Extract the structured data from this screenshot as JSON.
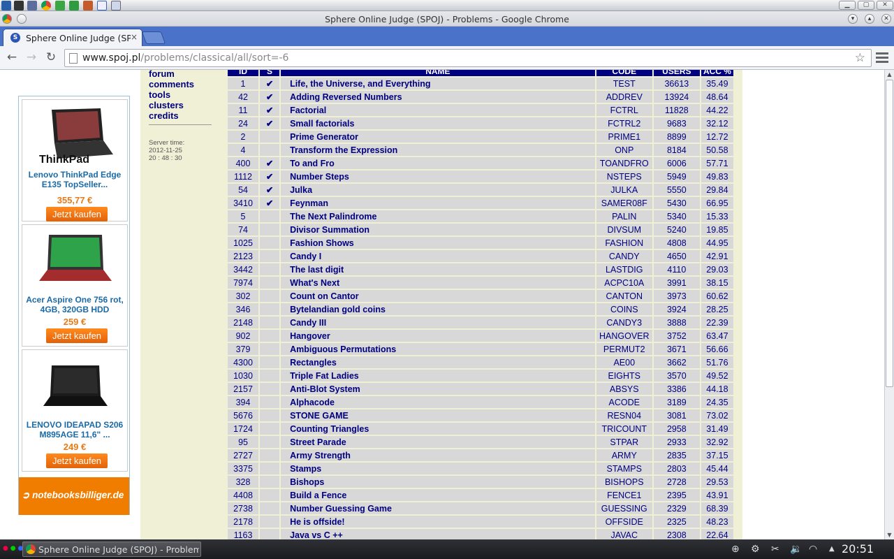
{
  "os": {
    "launchers": [
      "kde-icon",
      "terminal-icon",
      "filemanager-icon",
      "chrome-icon",
      "libreoffice-icon",
      "spreadsheet-icon",
      "network-icon",
      "notes-icon"
    ]
  },
  "window": {
    "title": "Sphere Online Judge (SPOJ) - Problems - Google Chrome"
  },
  "tab": {
    "title": "Sphere Online Judge (SP",
    "close": "×"
  },
  "toolbar": {
    "back": "←",
    "forward": "→",
    "reload": "↻",
    "url_host": "www.spoj.pl",
    "url_path": "/problems/classical/all/sort=-6",
    "star": "☆"
  },
  "ads": {
    "choice": "▷",
    "items": [
      {
        "name": "Lenovo ThinkPad Edge E135 TopSeller...",
        "price": "355,77 €",
        "buy": "Jetzt kaufen"
      },
      {
        "name": "Acer Aspire One 756 rot, 4GB, 320GB HDD",
        "price": "259 €",
        "buy": "Jetzt kaufen"
      },
      {
        "name": "LENOVO IDEAPAD S206 M895AGE 11,6\" ...",
        "price": "249 €",
        "buy": "Jetzt kaufen"
      }
    ],
    "brand": "notebooksbilliger.de",
    "brand_logo_text": "ThinkPad"
  },
  "nav": {
    "links": [
      "forum",
      "comments",
      "tools",
      "clusters",
      "credits"
    ],
    "server_time_label": "Server time:",
    "server_date": "2012-11-25",
    "server_clock": "20 : 48 : 30"
  },
  "table": {
    "headers": [
      "ID",
      "S",
      "NAME",
      "CODE",
      "USERS",
      "ACC %"
    ],
    "rows": [
      {
        "id": "1",
        "solved": true,
        "name": "Life, the Universe, and Everything",
        "code": "TEST",
        "users": "36613",
        "acc": "35.49"
      },
      {
        "id": "42",
        "solved": true,
        "name": "Adding Reversed Numbers",
        "code": "ADDREV",
        "users": "13924",
        "acc": "48.64"
      },
      {
        "id": "11",
        "solved": true,
        "name": "Factorial",
        "code": "FCTRL",
        "users": "11828",
        "acc": "44.22"
      },
      {
        "id": "24",
        "solved": true,
        "name": "Small factorials",
        "code": "FCTRL2",
        "users": "9683",
        "acc": "32.12"
      },
      {
        "id": "2",
        "solved": false,
        "name": "Prime Generator",
        "code": "PRIME1",
        "users": "8899",
        "acc": "12.72"
      },
      {
        "id": "4",
        "solved": false,
        "name": "Transform the Expression",
        "code": "ONP",
        "users": "8184",
        "acc": "50.58"
      },
      {
        "id": "400",
        "solved": true,
        "name": "To and Fro",
        "code": "TOANDFRO",
        "users": "6006",
        "acc": "57.71"
      },
      {
        "id": "1112",
        "solved": true,
        "name": "Number Steps",
        "code": "NSTEPS",
        "users": "5949",
        "acc": "49.83"
      },
      {
        "id": "54",
        "solved": true,
        "name": "Julka",
        "code": "JULKA",
        "users": "5550",
        "acc": "29.84"
      },
      {
        "id": "3410",
        "solved": true,
        "name": "Feynman",
        "code": "SAMER08F",
        "users": "5430",
        "acc": "66.95"
      },
      {
        "id": "5",
        "solved": false,
        "name": "The Next Palindrome",
        "code": "PALIN",
        "users": "5340",
        "acc": "15.33"
      },
      {
        "id": "74",
        "solved": false,
        "name": "Divisor Summation",
        "code": "DIVSUM",
        "users": "5240",
        "acc": "19.85"
      },
      {
        "id": "1025",
        "solved": false,
        "name": "Fashion Shows",
        "code": "FASHION",
        "users": "4808",
        "acc": "44.95"
      },
      {
        "id": "2123",
        "solved": false,
        "name": "Candy I",
        "code": "CANDY",
        "users": "4650",
        "acc": "42.91"
      },
      {
        "id": "3442",
        "solved": false,
        "name": "The last digit",
        "code": "LASTDIG",
        "users": "4110",
        "acc": "29.03"
      },
      {
        "id": "7974",
        "solved": false,
        "name": "What's Next",
        "code": "ACPC10A",
        "users": "3991",
        "acc": "38.15"
      },
      {
        "id": "302",
        "solved": false,
        "name": "Count on Cantor",
        "code": "CANTON",
        "users": "3973",
        "acc": "60.62"
      },
      {
        "id": "346",
        "solved": false,
        "name": "Bytelandian gold coins",
        "code": "COINS",
        "users": "3924",
        "acc": "28.25"
      },
      {
        "id": "2148",
        "solved": false,
        "name": "Candy III",
        "code": "CANDY3",
        "users": "3888",
        "acc": "22.39"
      },
      {
        "id": "902",
        "solved": false,
        "name": "Hangover",
        "code": "HANGOVER",
        "users": "3752",
        "acc": "63.47"
      },
      {
        "id": "379",
        "solved": false,
        "name": "Ambiguous Permutations",
        "code": "PERMUT2",
        "users": "3671",
        "acc": "56.66"
      },
      {
        "id": "4300",
        "solved": false,
        "name": "Rectangles",
        "code": "AE00",
        "users": "3662",
        "acc": "51.76"
      },
      {
        "id": "1030",
        "solved": false,
        "name": "Triple Fat Ladies",
        "code": "EIGHTS",
        "users": "3570",
        "acc": "49.52"
      },
      {
        "id": "2157",
        "solved": false,
        "name": "Anti-Blot System",
        "code": "ABSYS",
        "users": "3386",
        "acc": "44.18"
      },
      {
        "id": "394",
        "solved": false,
        "name": "Alphacode",
        "code": "ACODE",
        "users": "3189",
        "acc": "24.35"
      },
      {
        "id": "5676",
        "solved": false,
        "name": "STONE GAME",
        "code": "RESN04",
        "users": "3081",
        "acc": "73.02"
      },
      {
        "id": "1724",
        "solved": false,
        "name": "Counting Triangles",
        "code": "TRICOUNT",
        "users": "2958",
        "acc": "31.49"
      },
      {
        "id": "95",
        "solved": false,
        "name": "Street Parade",
        "code": "STPAR",
        "users": "2933",
        "acc": "32.92"
      },
      {
        "id": "2727",
        "solved": false,
        "name": "Army Strength",
        "code": "ARMY",
        "users": "2835",
        "acc": "37.15"
      },
      {
        "id": "3375",
        "solved": false,
        "name": "Stamps",
        "code": "STAMPS",
        "users": "2803",
        "acc": "45.44"
      },
      {
        "id": "328",
        "solved": false,
        "name": "Bishops",
        "code": "BISHOPS",
        "users": "2728",
        "acc": "29.53"
      },
      {
        "id": "4408",
        "solved": false,
        "name": "Build a Fence",
        "code": "FENCE1",
        "users": "2395",
        "acc": "43.91"
      },
      {
        "id": "2738",
        "solved": false,
        "name": "Number Guessing Game",
        "code": "GUESSING",
        "users": "2329",
        "acc": "68.39"
      },
      {
        "id": "2178",
        "solved": false,
        "name": "He is offside!",
        "code": "OFFSIDE",
        "users": "2325",
        "acc": "48.23"
      },
      {
        "id": "1163",
        "solved": false,
        "name": "Java vs C ++",
        "code": "JAVAC",
        "users": "2308",
        "acc": "22.64"
      }
    ],
    "check_mark": "✔"
  },
  "taskbar": {
    "task_label": "Sphere Online Judge (SPOJ) - Problem",
    "clock": "20:51"
  },
  "colors": {
    "table_header": "#000080",
    "row_bg": "#d8d8d8",
    "page_bg": "#f0f0d7",
    "check": "#e00000",
    "tab_strip": "#4a72c9"
  }
}
